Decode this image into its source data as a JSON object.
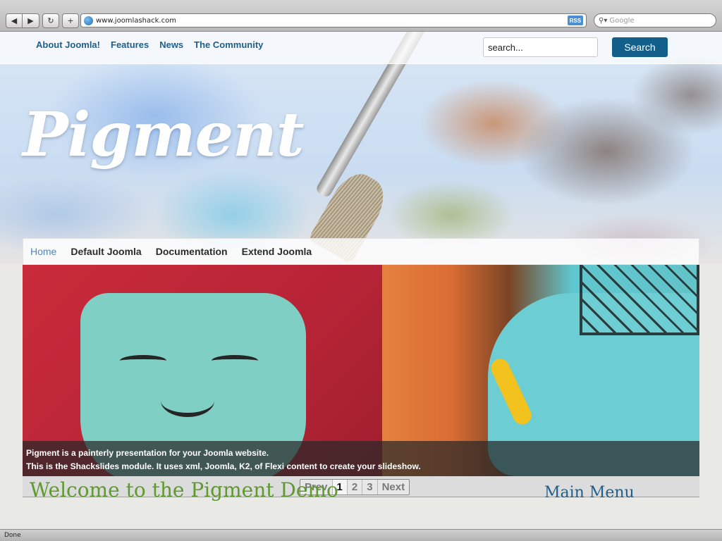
{
  "browser": {
    "url": "www.joomlashack.com",
    "rss_label": "RSS",
    "search_placeholder": "Google",
    "nav": {
      "back": "◀",
      "forward": "▶",
      "reload": "↻",
      "add": "+"
    },
    "status": "Done"
  },
  "top_nav": {
    "links": [
      "About Joomla!",
      "Features",
      "News",
      "The Community"
    ],
    "search_value": "search...",
    "search_button": "Search"
  },
  "site": {
    "logo": "Pigment"
  },
  "main_menu": {
    "items": [
      "Home",
      "Default Joomla",
      "Documentation",
      "Extend Joomla"
    ],
    "active": "Home"
  },
  "slideshow": {
    "caption_line1": "Pigment is a painterly presentation for your Joomla website.",
    "caption_line2": "This is the Shackslides module. It uses xml, Joomla, K2, of Flexi content to create your slideshow.",
    "pager": [
      "Prev",
      "1",
      "2",
      "3",
      "Next"
    ],
    "current_page": "1"
  },
  "content": {
    "heading": "Welcome to the Pigment Demo",
    "sidebar_heading": "Main Menu"
  },
  "colors": {
    "link_blue": "#1d5f8c",
    "search_button_bg": "#135f8c",
    "menu_active": "#4d86c4",
    "heading_green": "#5e9a2e"
  }
}
